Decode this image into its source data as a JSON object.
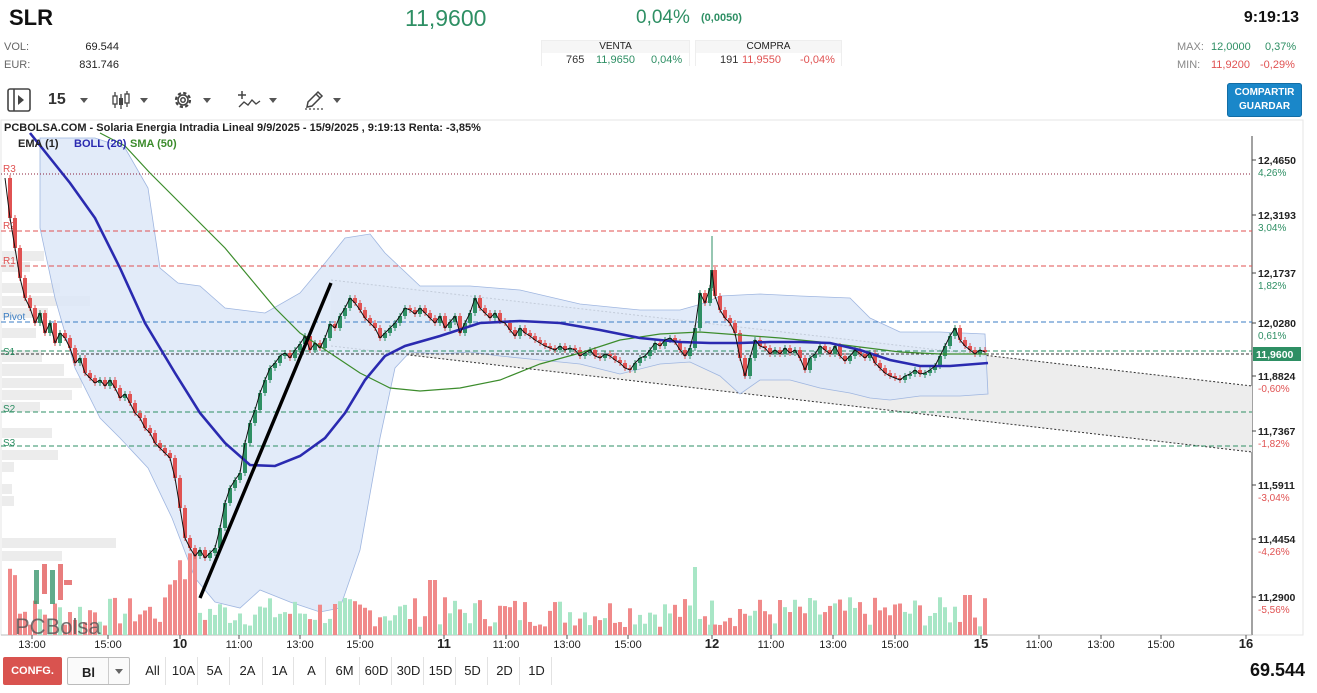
{
  "header": {
    "ticker": "SLR",
    "last_price": "11,9600",
    "change_pct": "0,04%",
    "change_abs": "(0,0050)",
    "time": "9:19:13",
    "vol_label": "VOL:",
    "vol_value": "69.544",
    "eur_label": "EUR:",
    "eur_value": "831.746",
    "venta": {
      "title": "VENTA",
      "qty": "765",
      "price": "11,9650",
      "pct": "0,04%"
    },
    "compra": {
      "title": "COMPRA",
      "qty": "191",
      "price": "11,9550",
      "pct": "-0,04%"
    },
    "max_label": "MAX:",
    "max_value": "12,0000",
    "max_pct": "0,37%",
    "min_label": "MIN:",
    "min_value": "11,9200",
    "min_pct": "-0,29%"
  },
  "toolbar": {
    "interval": "15",
    "share_label": "COMPARTIR",
    "save_label": "GUARDAR"
  },
  "chart_title": "PCBOLSA.COM - Solaria Energia Intradia Lineal 9/9/2025 - 15/9/2025 , 9:19:13 Renta: -3,85%",
  "legend": {
    "ema": "EMA (1)",
    "boll": "BOLL (20)",
    "sma": "SMA (50)"
  },
  "watermark": "PCBolsa",
  "price_axis": {
    "ticks": [
      {
        "price": "12,4650",
        "pct": "4,26%"
      },
      {
        "price": "12,3193",
        "pct": "3,04%"
      },
      {
        "price": "12,1737",
        "pct": "1,82%"
      },
      {
        "price": "12,0280",
        "pct": "0,61%"
      },
      {
        "price": "11,8824",
        "pct": "-0,60%"
      },
      {
        "price": "11,7367",
        "pct": "-1,82%"
      },
      {
        "price": "11,5911",
        "pct": "-3,04%"
      },
      {
        "price": "11,4454",
        "pct": "-4,26%"
      },
      {
        "price": "11,2900",
        "pct": "-5,56%"
      }
    ],
    "current": "11,9600"
  },
  "pivot_labels": [
    "R3",
    "R2",
    "R1",
    "Pivot",
    "S1",
    "S2",
    "S3"
  ],
  "time_axis": [
    {
      "label": "13:00",
      "bold": false
    },
    {
      "label": "15:00",
      "bold": false
    },
    {
      "label": "10",
      "bold": true
    },
    {
      "label": "11:00",
      "bold": false
    },
    {
      "label": "13:00",
      "bold": false
    },
    {
      "label": "15:00",
      "bold": false
    },
    {
      "label": "11",
      "bold": true
    },
    {
      "label": "11:00",
      "bold": false
    },
    {
      "label": "13:00",
      "bold": false
    },
    {
      "label": "15:00",
      "bold": false
    },
    {
      "label": "12",
      "bold": true
    },
    {
      "label": "11:00",
      "bold": false
    },
    {
      "label": "13:00",
      "bold": false
    },
    {
      "label": "15:00",
      "bold": false
    },
    {
      "label": "15",
      "bold": true
    },
    {
      "label": "11:00",
      "bold": false
    },
    {
      "label": "13:00",
      "bold": false
    },
    {
      "label": "15:00",
      "bold": false
    },
    {
      "label": "16",
      "bold": true
    }
  ],
  "footer": {
    "config_label": "CONFG.",
    "mode": "Bl",
    "ranges": [
      "All",
      "10A",
      "5A",
      "2A",
      "1A",
      "A",
      "6M",
      "60D",
      "30D",
      "15D",
      "5D",
      "2D",
      "1D"
    ],
    "volume": "69.544"
  },
  "colors": {
    "up": "#2e8f64",
    "down": "#e05252",
    "ema": "#111111",
    "boll": "#2222aa",
    "sma": "#3c8c2c",
    "band": "#dbe7f7"
  }
}
